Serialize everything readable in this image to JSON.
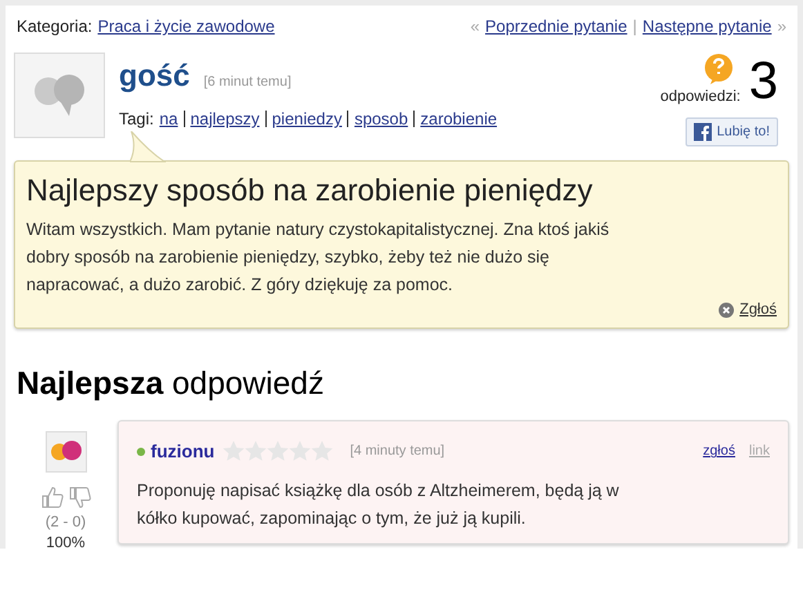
{
  "category": {
    "label": "Kategoria:",
    "link": "Praca i życie zawodowe"
  },
  "nav": {
    "prev_mark": "«",
    "prev": "Poprzednie pytanie",
    "separator": "|",
    "next": "Następne pytanie",
    "next_mark": "»"
  },
  "question": {
    "author": "gość",
    "time": "[6 minut temu]",
    "tags_label": "Tagi:",
    "tags": [
      "na",
      "najlepszy",
      "pieniedzy",
      "sposob",
      "zarobienie"
    ],
    "answers_label": "odpowiedzi:",
    "answers_count": "3",
    "like_button": "Lubię to!",
    "title": "Najlepszy sposób na zarobienie pieniędzy",
    "body": "Witam wszystkich. Mam pytanie natury czystokapitalistycznej. Zna ktoś jakiś dobry sposób na zarobienie pieniędzy, szybko, żeby też nie dużo się napracować, a dużo zarobić. Z góry dziękuję za pomoc.",
    "report": "Zgłoś"
  },
  "best_answer": {
    "heading": "**Najlepsza** odpowiedź",
    "author": "fuzionu",
    "online": true,
    "stars": 0,
    "time": "[4 minuty temu]",
    "report": "zgłoś",
    "link": "link",
    "text": "Proponuję napisać książkę dla osób z Altzheimerem, będą ją w kółko kupować, zapominając o tym, że już ją kupili.",
    "votes": "(2 - 0)",
    "percent": "100%"
  }
}
